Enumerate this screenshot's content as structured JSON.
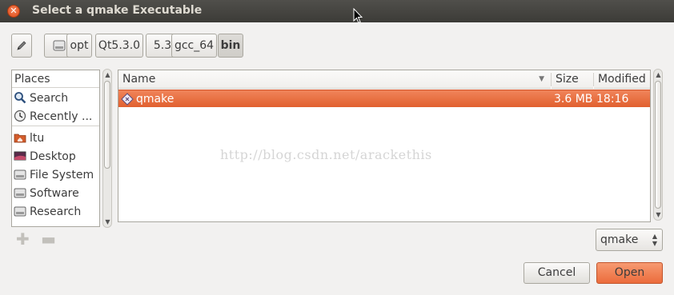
{
  "window": {
    "title": "Select a qmake Executable",
    "close_glyph": "✕"
  },
  "pathbar": {
    "edit_icon": "pencil-icon",
    "root_icon": "drive-icon",
    "segments": [
      "opt",
      "Qt5.3.0",
      "5.3",
      "gcc_64",
      "bin"
    ],
    "active_segment": "bin"
  },
  "places": {
    "header": "Places",
    "items": [
      {
        "label": "Search",
        "icon": "search-icon"
      },
      {
        "label": "Recently ...",
        "icon": "recent-icon"
      },
      {
        "label": "ltu",
        "icon": "home-folder-icon"
      },
      {
        "label": "Desktop",
        "icon": "desktop-icon"
      },
      {
        "label": "File System",
        "icon": "drive-icon"
      },
      {
        "label": "Software",
        "icon": "drive-icon"
      },
      {
        "label": "Research",
        "icon": "drive-icon"
      }
    ]
  },
  "files": {
    "columns": {
      "name": "Name",
      "size": "Size",
      "modified": "Modified"
    },
    "rows": [
      {
        "name": "qmake",
        "size": "3.6 MB",
        "modified": "18:16",
        "icon": "executable-icon",
        "selected": true
      }
    ]
  },
  "watermark": "http://blog.csdn.net/arackethis",
  "filter": {
    "value": "qmake"
  },
  "buttons": {
    "cancel": "Cancel",
    "open": "Open"
  },
  "colors": {
    "selection": "#e9693a",
    "titlebar": "#3c3b37",
    "open_button": "#f08556"
  }
}
